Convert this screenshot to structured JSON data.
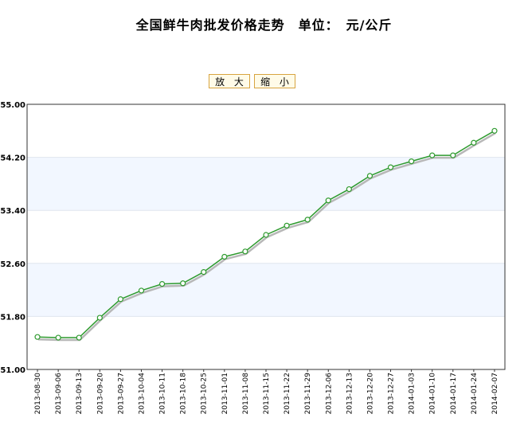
{
  "page_title": "全国鲜牛肉批发价格走势　单位：　元/公斤",
  "toolbar": {
    "zoom_in_label": "放 大",
    "zoom_out_label": "缩 小"
  },
  "colors": {
    "line": "#2e9a2e",
    "shadow": "#b8b8b8",
    "band": "#f2f7ff",
    "marker_fill": "#ffffff"
  },
  "chart_data": {
    "type": "line",
    "title": "全国鲜牛肉批发价格走势　单位：　元/公斤",
    "xlabel": "",
    "ylabel": "",
    "ylim": [
      51.0,
      55.0
    ],
    "yticks": [
      "51.00",
      "51.80",
      "52.60",
      "53.40",
      "54.20",
      "55.00"
    ],
    "grid": "alternating horizontal bands",
    "categories": [
      "2013-08-30",
      "2013-09-06",
      "2013-09-13",
      "2013-09-20",
      "2013-09-27",
      "2013-10-04",
      "2013-10-11",
      "2013-10-18",
      "2013-10-25",
      "2013-11-01",
      "2013-11-08",
      "2013-11-15",
      "2013-11-22",
      "2013-11-29",
      "2013-12-06",
      "2013-12-13",
      "2013-12-20",
      "2013-12-27",
      "2014-01-03",
      "2014-01-10",
      "2014-01-17",
      "2014-01-24",
      "2014-02-07"
    ],
    "values": [
      51.49,
      51.48,
      51.48,
      51.78,
      52.06,
      52.19,
      52.29,
      52.3,
      52.47,
      52.7,
      52.78,
      53.03,
      53.17,
      53.26,
      53.55,
      53.72,
      53.92,
      54.05,
      54.14,
      54.23,
      54.23,
      54.42,
      54.6
    ]
  }
}
